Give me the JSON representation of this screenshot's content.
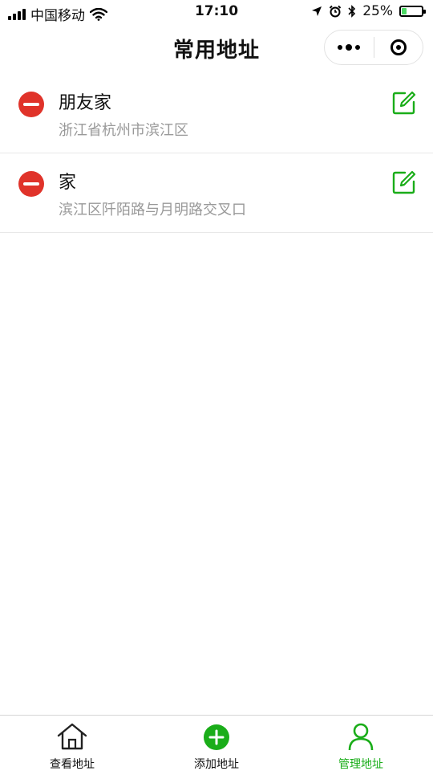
{
  "status_bar": {
    "carrier": "中国移动",
    "time": "17:10",
    "battery": "25%",
    "battery_level": 0.25,
    "icons": [
      "signal-icon",
      "wifi-icon",
      "location-arrow-icon",
      "alarm-icon",
      "bluetooth-icon",
      "battery-icon"
    ]
  },
  "nav": {
    "title": "常用地址",
    "menu_icon": "more-dots-icon",
    "close_icon": "target-circle-icon"
  },
  "addresses": [
    {
      "name": "朋友家",
      "detail": "浙江省杭州市滨江区"
    },
    {
      "name": "家",
      "detail": "滨江区阡陌路与月明路交叉口"
    }
  ],
  "tabs": [
    {
      "label": "查看地址",
      "icon": "home-icon",
      "active": false
    },
    {
      "label": "添加地址",
      "icon": "add-circle-icon",
      "active": false
    },
    {
      "label": "管理地址",
      "icon": "user-manage-icon",
      "active": true
    }
  ],
  "colors": {
    "accent": "#1aad19",
    "delete": "#e0332a",
    "subtext": "#999999"
  }
}
